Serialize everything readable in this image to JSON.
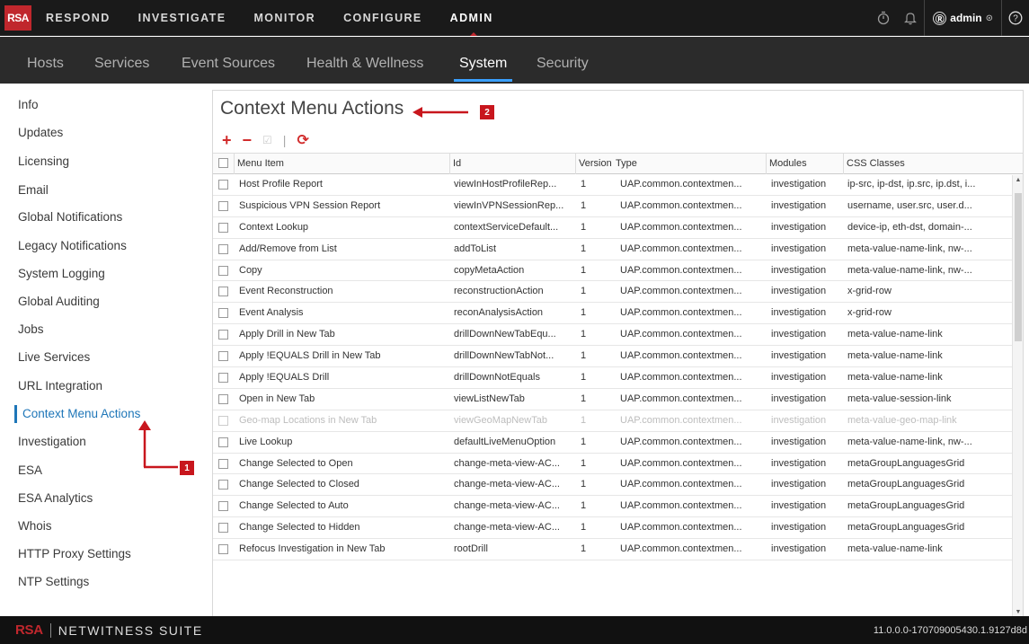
{
  "topbar": {
    "logo": "RSA",
    "nav": [
      "RESPOND",
      "INVESTIGATE",
      "MONITOR",
      "CONFIGURE",
      "ADMIN"
    ],
    "active": "ADMIN",
    "user": "admin"
  },
  "subnav": {
    "items": [
      "Hosts",
      "Services",
      "Event Sources",
      "Health & Wellness",
      "System",
      "Security"
    ],
    "active": "System"
  },
  "sidebar": {
    "items": [
      "Info",
      "Updates",
      "Licensing",
      "Email",
      "Global Notifications",
      "Legacy Notifications",
      "System Logging",
      "Global Auditing",
      "Jobs",
      "Live Services",
      "URL Integration",
      "Context Menu Actions",
      "Investigation",
      "ESA",
      "ESA Analytics",
      "Whois",
      "HTTP Proxy Settings",
      "NTP Settings"
    ],
    "active": "Context Menu Actions"
  },
  "content": {
    "title": "Context Menu Actions",
    "toolbar": {
      "add": "+",
      "remove": "−",
      "edit": "☑",
      "divider": "|",
      "refresh": "⟳"
    },
    "columns": [
      "Menu Item",
      "Id",
      "Version",
      "Type",
      "Modules",
      "CSS Classes"
    ],
    "rows": [
      [
        "Host Profile Report",
        "viewInHostProfileRep...",
        "1",
        "UAP.common.contextmen...",
        "investigation",
        "ip-src, ip-dst, ip.src, ip.dst, i..."
      ],
      [
        "Suspicious VPN Session Report",
        "viewInVPNSessionRep...",
        "1",
        "UAP.common.contextmen...",
        "investigation",
        "username, user.src, user.d..."
      ],
      [
        "Context Lookup",
        "contextServiceDefault...",
        "1",
        "UAP.common.contextmen...",
        "investigation",
        "device-ip, eth-dst, domain-..."
      ],
      [
        "Add/Remove from List",
        "addToList",
        "1",
        "UAP.common.contextmen...",
        "investigation",
        "meta-value-name-link, nw-..."
      ],
      [
        "Copy",
        "copyMetaAction",
        "1",
        "UAP.common.contextmen...",
        "investigation",
        "meta-value-name-link, nw-..."
      ],
      [
        "Event Reconstruction",
        "reconstructionAction",
        "1",
        "UAP.common.contextmen...",
        "investigation",
        "x-grid-row"
      ],
      [
        "Event Analysis",
        "reconAnalysisAction",
        "1",
        "UAP.common.contextmen...",
        "investigation",
        "x-grid-row"
      ],
      [
        "Apply Drill in New Tab",
        "drillDownNewTabEqu...",
        "1",
        "UAP.common.contextmen...",
        "investigation",
        "meta-value-name-link"
      ],
      [
        "Apply !EQUALS Drill in New Tab",
        "drillDownNewTabNot...",
        "1",
        "UAP.common.contextmen...",
        "investigation",
        "meta-value-name-link"
      ],
      [
        "Apply !EQUALS Drill",
        "drillDownNotEquals",
        "1",
        "UAP.common.contextmen...",
        "investigation",
        "meta-value-name-link"
      ],
      [
        "Open in New Tab",
        "viewListNewTab",
        "1",
        "UAP.common.contextmen...",
        "investigation",
        "meta-value-session-link"
      ],
      [
        "Geo-map Locations in New Tab",
        "viewGeoMapNewTab",
        "1",
        "UAP.common.contextmen...",
        "investigation",
        "meta-value-geo-map-link"
      ],
      [
        "Live Lookup",
        "defaultLiveMenuOption",
        "1",
        "UAP.common.contextmen...",
        "investigation",
        "meta-value-name-link, nw-..."
      ],
      [
        "Change Selected to Open",
        "change-meta-view-AC...",
        "1",
        "UAP.common.contextmen...",
        "investigation",
        "metaGroupLanguagesGrid"
      ],
      [
        "Change Selected to Closed",
        "change-meta-view-AC...",
        "1",
        "UAP.common.contextmen...",
        "investigation",
        "metaGroupLanguagesGrid"
      ],
      [
        "Change Selected to Auto",
        "change-meta-view-AC...",
        "1",
        "UAP.common.contextmen...",
        "investigation",
        "metaGroupLanguagesGrid"
      ],
      [
        "Change Selected to Hidden",
        "change-meta-view-AC...",
        "1",
        "UAP.common.contextmen...",
        "investigation",
        "metaGroupLanguagesGrid"
      ],
      [
        "Refocus Investigation in New Tab",
        "rootDrill",
        "1",
        "UAP.common.contextmen...",
        "investigation",
        "meta-value-name-link"
      ]
    ],
    "dimmed_row": "Geo-map Locations in New Tab"
  },
  "annotations": {
    "badge1": "1",
    "badge2": "2"
  },
  "footer": {
    "brand": "RSA",
    "suite": "NETWITNESS SUITE",
    "version": "11.0.0.0-170709005430.1.9127d8d"
  },
  "colors": {
    "brand_red": "#c0272d",
    "active_blue": "#1e76b8",
    "tab_underline": "#3aa0ff"
  }
}
